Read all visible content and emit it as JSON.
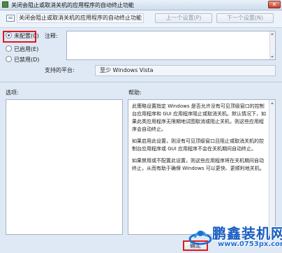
{
  "window": {
    "title": "关闭会阻止或取消关机的应用程序的自动终止功能",
    "close_glyph": "✕"
  },
  "header": {
    "policy_title": "关闭会阻止或取消关机的应用程序的自动终止功能",
    "prev_button": "上一个设置(P)",
    "next_button": "下一个设置(N)"
  },
  "state": {
    "options": [
      {
        "label": "未配置(C)",
        "selected": true
      },
      {
        "label": "已启用(E)",
        "selected": false
      },
      {
        "label": "已禁用(D)",
        "selected": false
      }
    ]
  },
  "comment": {
    "label": "注释:",
    "value": ""
  },
  "platform": {
    "label": "支持的平台:",
    "value": "至少 Windows Vista"
  },
  "options_pane": {
    "label": "选项:"
  },
  "help_pane": {
    "label": "帮助:",
    "paragraphs": [
      "此策略设置指定 Windows 是否允许没有可见顶级窗口的控制台应用程序和 GUI 应用程序阻止或取消关机。默认情况下，如果此类应用程序无限期地试图取消或阻止关机，则这些应用程序会自动终止。",
      "如果启用此设置，则没有可见顶级窗口且阻止或取消关机的控制台应用程序或 GUI 应用程序不会在关机期间自动终止。",
      "如果禁用或不配置此设置，则这些应用程序将在关机期间自动终止，从而有助于确保 Windows 可以更快、更顺利地关机。"
    ]
  },
  "footer": {
    "ok_button": "确定"
  },
  "watermark": {
    "brand": "鹏鑫装机网",
    "url": "www.0753px.com"
  },
  "colors": {
    "highlight_box": "#e0191b",
    "watermark_blue": "#1a5ec1"
  }
}
